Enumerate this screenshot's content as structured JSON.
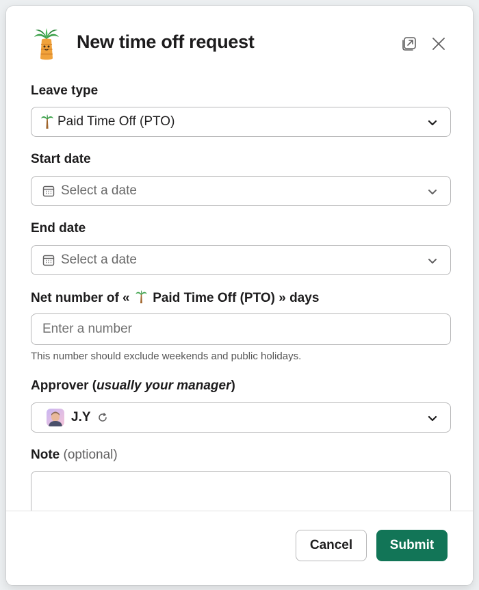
{
  "header": {
    "title": "New time off request"
  },
  "form": {
    "leave_type": {
      "label": "Leave type",
      "value": "Paid Time Off (PTO)"
    },
    "start_date": {
      "label": "Start date",
      "placeholder": "Select a date"
    },
    "end_date": {
      "label": "End date",
      "placeholder": "Select a date"
    },
    "net_days": {
      "label_prefix": "Net number of «",
      "label_type": "Paid Time Off (PTO)",
      "label_suffix": "» days",
      "placeholder": "Enter a number",
      "hint": "This number should exclude weekends and public holidays."
    },
    "approver": {
      "label": "Approver (",
      "label_italic": "usually your manager",
      "label_end": ")",
      "value": "J.Y"
    },
    "note": {
      "label": "Note",
      "label_muted": "(optional)"
    }
  },
  "footer": {
    "cancel_label": "Cancel",
    "submit_label": "Submit"
  },
  "colors": {
    "submit": "#127557",
    "border": "#b7b7b8"
  },
  "icons": [
    "palm-tree-icon",
    "popout-icon",
    "close-icon",
    "chevron-down-icon",
    "calendar-icon",
    "refresh-icon",
    "avatar"
  ]
}
